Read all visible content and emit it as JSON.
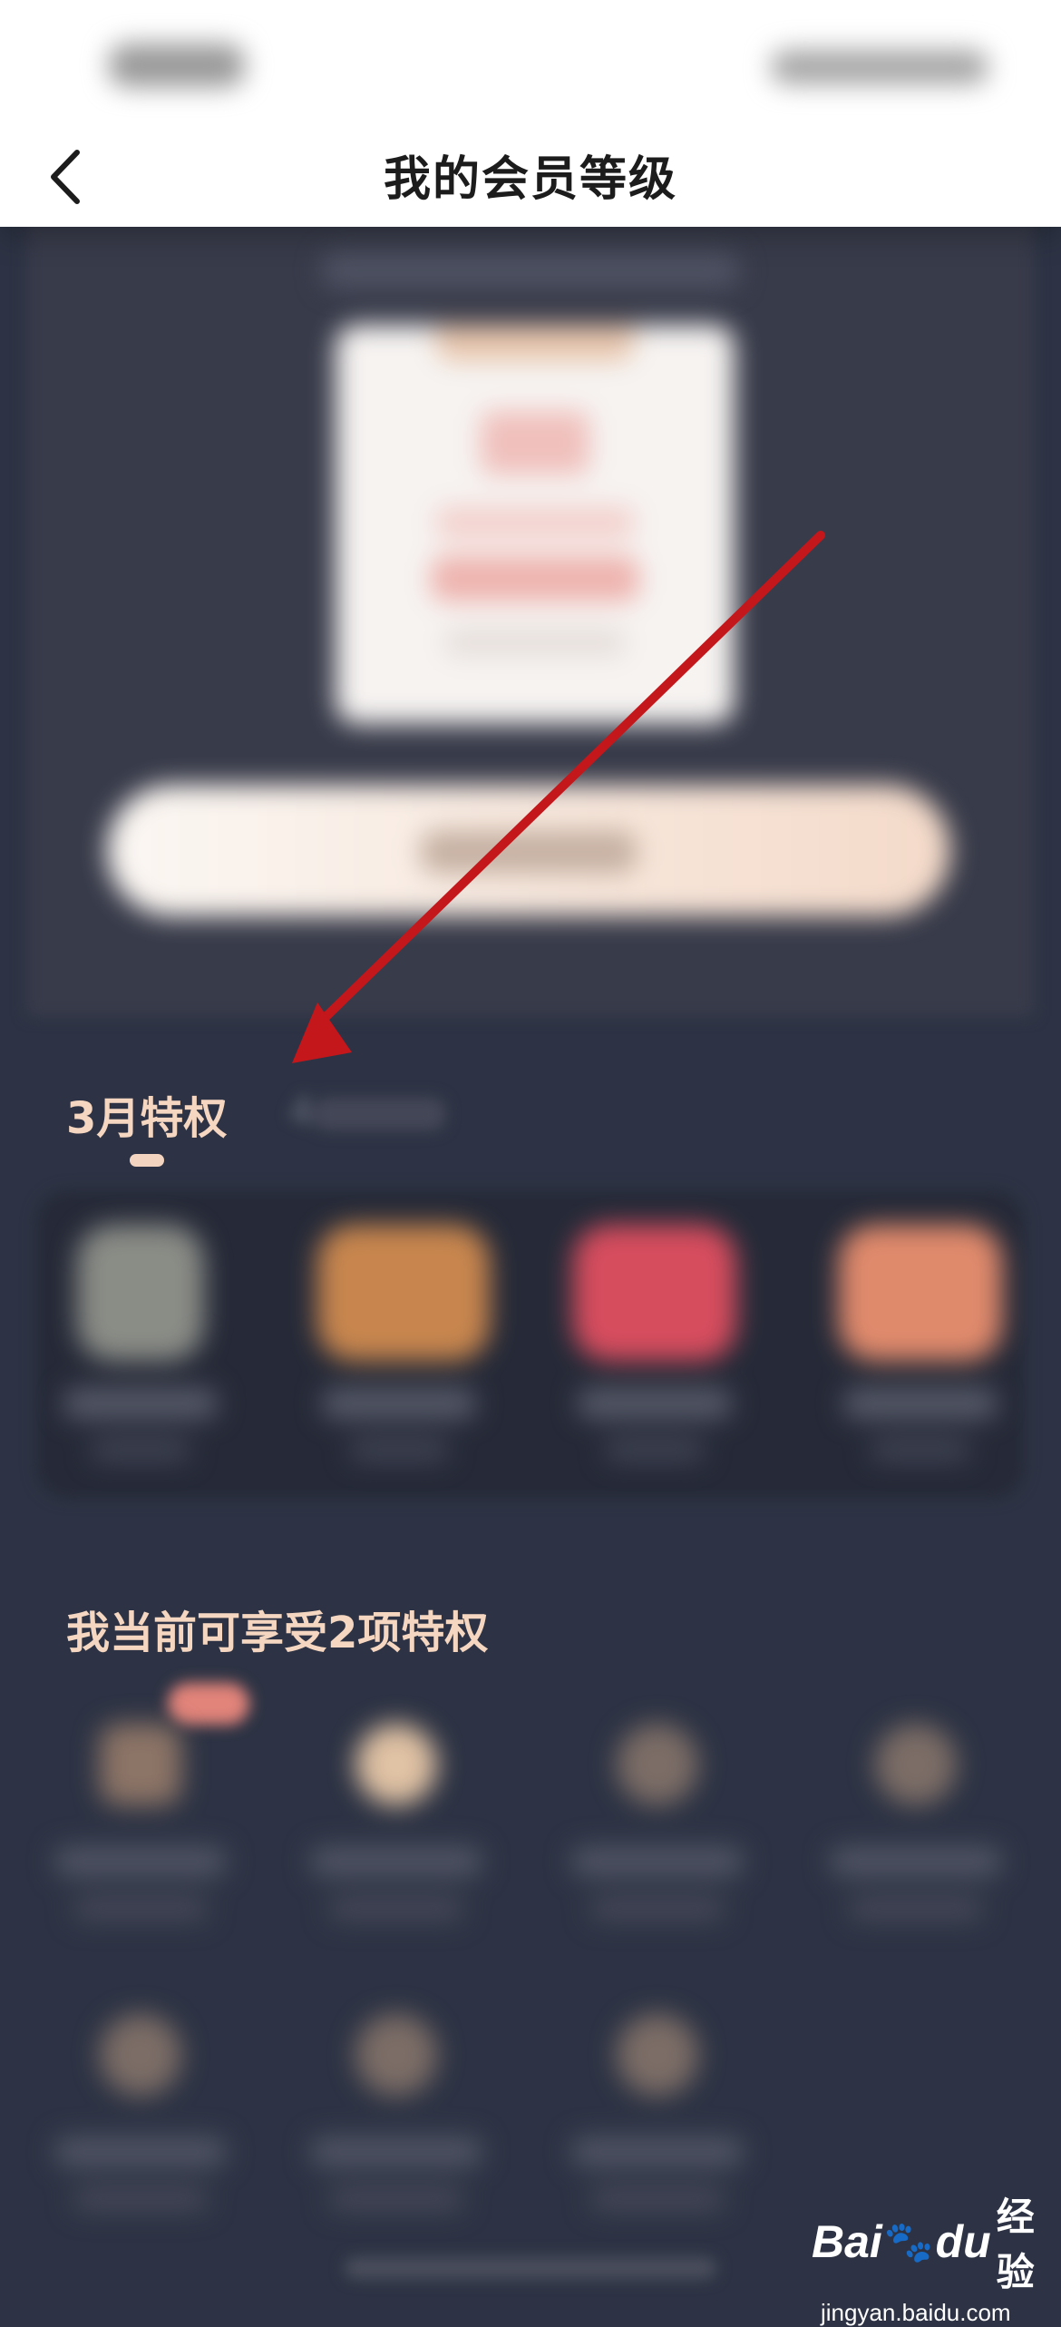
{
  "header": {
    "title": "我的会员等级",
    "back_icon": "chevron-left-icon"
  },
  "privileges_section": {
    "active_month_tab": "3月特权",
    "next_month_tab_visible": "4",
    "items_count": 4
  },
  "current_section": {
    "title": "我当前可享受2项特权"
  },
  "watermark": {
    "brand": "Bai",
    "brand_cn": "经验",
    "url": "jingyan.baidu.com"
  },
  "colors": {
    "background": "#2d3344",
    "accent_text": "#f5d6c0",
    "annotation_arrow": "#c4171b"
  }
}
